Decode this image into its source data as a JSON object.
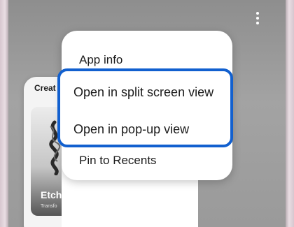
{
  "background_app": {
    "title": "Creat",
    "tile_name": "Etch",
    "tile_subtitle": "Transfo"
  },
  "overflow_menu": {
    "icon": "more-vertical-icon"
  },
  "context_menu": {
    "items": [
      {
        "label": "App info"
      },
      {
        "label": "Open in split screen view"
      },
      {
        "label": "Open in pop-up view"
      },
      {
        "label": "Pin to Recents"
      }
    ]
  },
  "colors": {
    "highlight_border": "#1260cf",
    "screen_background": "#9a9a9a",
    "phone_frame": "#e9dde3"
  }
}
